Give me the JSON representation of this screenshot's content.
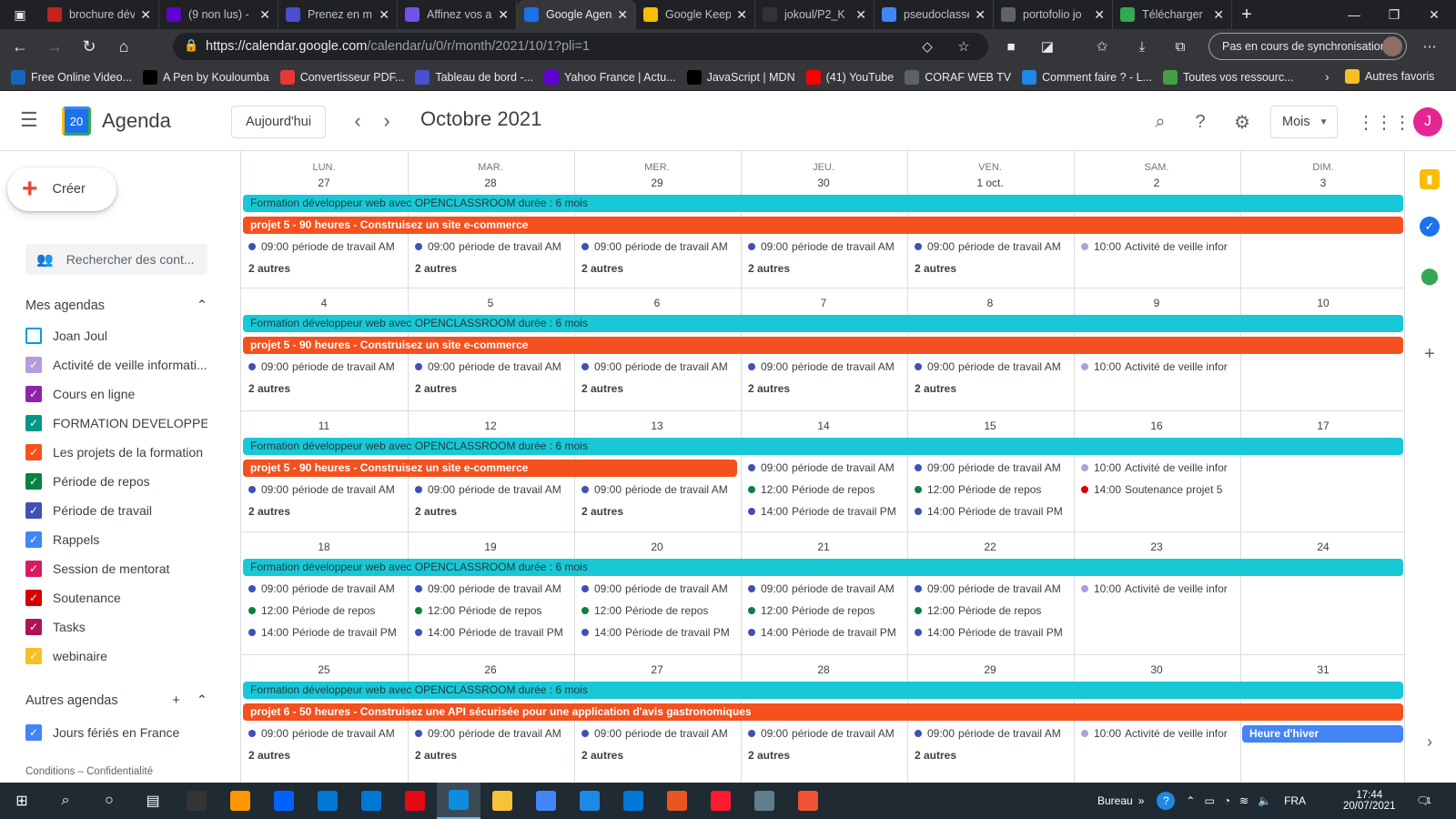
{
  "browser": {
    "tabs": [
      {
        "title": "brochure dév",
        "color": "#c5221f"
      },
      {
        "title": "(9 non lus) -",
        "color": "#6001d2"
      },
      {
        "title": "Prenez en m",
        "color": "#4a4ed1"
      },
      {
        "title": "Affinez vos a",
        "color": "#7451eb"
      },
      {
        "title": "Google Agen",
        "color": "#1a73e8"
      },
      {
        "title": "Google Keep",
        "color": "#fbbc04"
      },
      {
        "title": "jokoul/P2_K",
        "color": "#333333"
      },
      {
        "title": "pseudoclasse",
        "color": "#4285f4"
      },
      {
        "title": "portofolio jo",
        "color": "#5f6368"
      },
      {
        "title": "Télécharger",
        "color": "#34a853"
      }
    ],
    "active_tab_index": 4,
    "url_host": "https://calendar.google.com",
    "url_path": "/calendar/u/0/r/month/2021/10/1?pli=1",
    "sync_label": "Pas en cours de synchronisation",
    "bookmarks": [
      {
        "label": "Free Online Video...",
        "color": "#1565c0"
      },
      {
        "label": "A Pen by Kouloumba",
        "color": "#000000"
      },
      {
        "label": "Convertisseur PDF...",
        "color": "#e53935"
      },
      {
        "label": "Tableau de bord -...",
        "color": "#4a4ed1"
      },
      {
        "label": "Yahoo France | Actu...",
        "color": "#6001d2"
      },
      {
        "label": "JavaScript | MDN",
        "color": "#000000"
      },
      {
        "label": "(41) YouTube",
        "color": "#ff0000"
      },
      {
        "label": "CORAF WEB TV",
        "color": "#5f6368"
      },
      {
        "label": "Comment faire ? - L...",
        "color": "#1e88e5"
      },
      {
        "label": "Toutes vos ressourc...",
        "color": "#43a047"
      }
    ],
    "other_bookmarks": "Autres favoris"
  },
  "app": {
    "title": "Agenda",
    "logo_day": "20",
    "today_label": "Aujourd'hui",
    "month_title": "Octobre 2021",
    "view_label": "Mois",
    "avatar_letter": "J"
  },
  "sidebar": {
    "create_label": "Créer",
    "search_placeholder": "Rechercher des cont...",
    "my_calendars_title": "Mes agendas",
    "my_calendars": [
      {
        "label": "Joan Joul",
        "color": "#039be5",
        "checked": false
      },
      {
        "label": "Activité de veille informati...",
        "color": "#b39ddb",
        "checked": true
      },
      {
        "label": "Cours en ligne",
        "color": "#8e24aa",
        "checked": true
      },
      {
        "label": "FORMATION DEVELOPPE...",
        "color": "#009688",
        "checked": true
      },
      {
        "label": "Les projets de la formation",
        "color": "#f4511e",
        "checked": true
      },
      {
        "label": "Période de repos",
        "color": "#0b8043",
        "checked": true
      },
      {
        "label": "Période de travail",
        "color": "#3f51b5",
        "checked": true
      },
      {
        "label": "Rappels",
        "color": "#4285f4",
        "checked": true
      },
      {
        "label": "Session de mentorat",
        "color": "#d81b60",
        "checked": true
      },
      {
        "label": "Soutenance",
        "color": "#d50000",
        "checked": true
      },
      {
        "label": "Tasks",
        "color": "#ad1457",
        "checked": true
      },
      {
        "label": "webinaire",
        "color": "#f6bf26",
        "checked": true
      }
    ],
    "other_calendars_title": "Autres agendas",
    "other_calendars": [
      {
        "label": "Jours fériés en France",
        "color": "#4285f4",
        "checked": true
      }
    ],
    "footer": "Conditions – Confidentialité"
  },
  "calendar": {
    "day_names": [
      "LUN.",
      "MAR.",
      "MER.",
      "JEU.",
      "VEN.",
      "SAM.",
      "DIM."
    ],
    "weeks": [
      {
        "days": [
          "27",
          "28",
          "29",
          "30",
          "1 oct.",
          "2",
          "3"
        ],
        "bars": [
          {
            "label": "Formation développeur web avec OPENCLASSROOM durée : 6 mois",
            "type": "teal",
            "row": 0,
            "start": 0,
            "end": 7
          },
          {
            "label": "projet 5 - 90 heures - Construisez un site e-commerce",
            "type": "orange",
            "row": 1,
            "start": 0,
            "end": 7
          }
        ],
        "events": [
          {
            "col": 0,
            "row": 2,
            "time": "09:00",
            "text": "période de travail AM",
            "color": "#3f51b5"
          },
          {
            "col": 1,
            "row": 2,
            "time": "09:00",
            "text": "période de travail AM",
            "color": "#3f51b5"
          },
          {
            "col": 2,
            "row": 2,
            "time": "09:00",
            "text": "période de travail AM",
            "color": "#3f51b5"
          },
          {
            "col": 3,
            "row": 2,
            "time": "09:00",
            "text": "période de travail AM",
            "color": "#3f51b5"
          },
          {
            "col": 4,
            "row": 2,
            "time": "09:00",
            "text": "période de travail AM",
            "color": "#3f51b5"
          },
          {
            "col": 5,
            "row": 2,
            "time": "10:00",
            "text": "Activité de veille infor",
            "color": "#b39ddb"
          }
        ],
        "more": [
          {
            "col": 0,
            "row": 3,
            "label": "2 autres"
          },
          {
            "col": 1,
            "row": 3,
            "label": "2 autres"
          },
          {
            "col": 2,
            "row": 3,
            "label": "2 autres"
          },
          {
            "col": 3,
            "row": 3,
            "label": "2 autres"
          },
          {
            "col": 4,
            "row": 3,
            "label": "2 autres"
          }
        ]
      },
      {
        "days": [
          "4",
          "5",
          "6",
          "7",
          "8",
          "9",
          "10"
        ],
        "bars": [
          {
            "label": "Formation développeur web avec OPENCLASSROOM durée : 6 mois",
            "type": "teal",
            "row": 0,
            "start": 0,
            "end": 7
          },
          {
            "label": "projet 5 - 90 heures - Construisez un site e-commerce",
            "type": "orange",
            "row": 1,
            "start": 0,
            "end": 7
          }
        ],
        "events": [
          {
            "col": 0,
            "row": 2,
            "time": "09:00",
            "text": "période de travail AM",
            "color": "#3f51b5"
          },
          {
            "col": 1,
            "row": 2,
            "time": "09:00",
            "text": "période de travail AM",
            "color": "#3f51b5"
          },
          {
            "col": 2,
            "row": 2,
            "time": "09:00",
            "text": "période de travail AM",
            "color": "#3f51b5"
          },
          {
            "col": 3,
            "row": 2,
            "time": "09:00",
            "text": "période de travail AM",
            "color": "#3f51b5"
          },
          {
            "col": 4,
            "row": 2,
            "time": "09:00",
            "text": "période de travail AM",
            "color": "#3f51b5"
          },
          {
            "col": 5,
            "row": 2,
            "time": "10:00",
            "text": "Activité de veille infor",
            "color": "#b39ddb"
          }
        ],
        "more": [
          {
            "col": 0,
            "row": 3,
            "label": "2 autres"
          },
          {
            "col": 1,
            "row": 3,
            "label": "2 autres"
          },
          {
            "col": 2,
            "row": 3,
            "label": "2 autres"
          },
          {
            "col": 3,
            "row": 3,
            "label": "2 autres"
          },
          {
            "col": 4,
            "row": 3,
            "label": "2 autres"
          }
        ]
      },
      {
        "days": [
          "11",
          "12",
          "13",
          "14",
          "15",
          "16",
          "17"
        ],
        "bars": [
          {
            "label": "Formation développeur web avec OPENCLASSROOM durée : 6 mois",
            "type": "teal",
            "row": 0,
            "start": 0,
            "end": 7
          },
          {
            "label": "projet 5 - 90 heures - Construisez un site e-commerce",
            "type": "orange",
            "row": 1,
            "start": 0,
            "end": 3
          }
        ],
        "events": [
          {
            "col": 0,
            "row": 2,
            "time": "09:00",
            "text": "période de travail AM",
            "color": "#3f51b5"
          },
          {
            "col": 1,
            "row": 2,
            "time": "09:00",
            "text": "période de travail AM",
            "color": "#3f51b5"
          },
          {
            "col": 2,
            "row": 2,
            "time": "09:00",
            "text": "période de travail AM",
            "color": "#3f51b5"
          },
          {
            "col": 3,
            "row": 1,
            "time": "09:00",
            "text": "période de travail AM",
            "color": "#3f51b5"
          },
          {
            "col": 3,
            "row": 2,
            "time": "12:00",
            "text": "Période de repos",
            "color": "#0b8043"
          },
          {
            "col": 3,
            "row": 3,
            "time": "14:00",
            "text": "Période de travail PM",
            "color": "#3f51b5"
          },
          {
            "col": 4,
            "row": 1,
            "time": "09:00",
            "text": "période de travail AM",
            "color": "#3f51b5"
          },
          {
            "col": 4,
            "row": 2,
            "time": "12:00",
            "text": "Période de repos",
            "color": "#0b8043"
          },
          {
            "col": 4,
            "row": 3,
            "time": "14:00",
            "text": "Période de travail PM",
            "color": "#3f51b5"
          },
          {
            "col": 5,
            "row": 1,
            "time": "10:00",
            "text": "Activité de veille infor",
            "color": "#b39ddb"
          },
          {
            "col": 5,
            "row": 2,
            "time": "14:00",
            "text": "Soutenance projet 5",
            "color": "#d50000"
          }
        ],
        "more": [
          {
            "col": 0,
            "row": 3,
            "label": "2 autres"
          },
          {
            "col": 1,
            "row": 3,
            "label": "2 autres"
          },
          {
            "col": 2,
            "row": 3,
            "label": "2 autres"
          }
        ]
      },
      {
        "days": [
          "18",
          "19",
          "20",
          "21",
          "22",
          "23",
          "24"
        ],
        "bars": [
          {
            "label": "Formation développeur web avec OPENCLASSROOM durée : 6 mois",
            "type": "teal",
            "row": 0,
            "start": 0,
            "end": 7
          }
        ],
        "events": [
          {
            "col": 0,
            "row": 1,
            "time": "09:00",
            "text": "période de travail AM",
            "color": "#3f51b5"
          },
          {
            "col": 0,
            "row": 2,
            "time": "12:00",
            "text": "Période de repos",
            "color": "#0b8043"
          },
          {
            "col": 0,
            "row": 3,
            "time": "14:00",
            "text": "Période de travail PM",
            "color": "#3f51b5"
          },
          {
            "col": 1,
            "row": 1,
            "time": "09:00",
            "text": "période de travail AM",
            "color": "#3f51b5"
          },
          {
            "col": 1,
            "row": 2,
            "time": "12:00",
            "text": "Période de repos",
            "color": "#0b8043"
          },
          {
            "col": 1,
            "row": 3,
            "time": "14:00",
            "text": "Période de travail PM",
            "color": "#3f51b5"
          },
          {
            "col": 2,
            "row": 1,
            "time": "09:00",
            "text": "période de travail AM",
            "color": "#3f51b5"
          },
          {
            "col": 2,
            "row": 2,
            "time": "12:00",
            "text": "Période de repos",
            "color": "#0b8043"
          },
          {
            "col": 2,
            "row": 3,
            "time": "14:00",
            "text": "Période de travail PM",
            "color": "#3f51b5"
          },
          {
            "col": 3,
            "row": 1,
            "time": "09:00",
            "text": "période de travail AM",
            "color": "#3f51b5"
          },
          {
            "col": 3,
            "row": 2,
            "time": "12:00",
            "text": "Période de repos",
            "color": "#0b8043"
          },
          {
            "col": 3,
            "row": 3,
            "time": "14:00",
            "text": "Période de travail PM",
            "color": "#3f51b5"
          },
          {
            "col": 4,
            "row": 1,
            "time": "09:00",
            "text": "période de travail AM",
            "color": "#3f51b5"
          },
          {
            "col": 4,
            "row": 2,
            "time": "12:00",
            "text": "Période de repos",
            "color": "#0b8043"
          },
          {
            "col": 4,
            "row": 3,
            "time": "14:00",
            "text": "Période de travail PM",
            "color": "#3f51b5"
          },
          {
            "col": 5,
            "row": 1,
            "time": "10:00",
            "text": "Activité de veille infor",
            "color": "#b39ddb"
          }
        ],
        "more": []
      },
      {
        "days": [
          "25",
          "26",
          "27",
          "28",
          "29",
          "30",
          "31"
        ],
        "bars": [
          {
            "label": "Formation développeur web avec OPENCLASSROOM durée : 6 mois",
            "type": "teal",
            "row": 0,
            "start": 0,
            "end": 7
          },
          {
            "label": "projet 6 - 50 heures - Construisez une API sécurisée pour une application d'avis gastronomiques",
            "type": "orange",
            "row": 1,
            "start": 0,
            "end": 7
          },
          {
            "label": "Heure d'hiver",
            "type": "blue",
            "row": 2,
            "start": 6,
            "end": 7
          }
        ],
        "events": [
          {
            "col": 0,
            "row": 2,
            "time": "09:00",
            "text": "période de travail AM",
            "color": "#3f51b5"
          },
          {
            "col": 1,
            "row": 2,
            "time": "09:00",
            "text": "période de travail AM",
            "color": "#3f51b5"
          },
          {
            "col": 2,
            "row": 2,
            "time": "09:00",
            "text": "période de travail AM",
            "color": "#3f51b5"
          },
          {
            "col": 3,
            "row": 2,
            "time": "09:00",
            "text": "période de travail AM",
            "color": "#3f51b5"
          },
          {
            "col": 4,
            "row": 2,
            "time": "09:00",
            "text": "période de travail AM",
            "color": "#3f51b5"
          },
          {
            "col": 5,
            "row": 2,
            "time": "10:00",
            "text": "Activité de veille infor",
            "color": "#b39ddb"
          }
        ],
        "more": [
          {
            "col": 0,
            "row": 3,
            "label": "2 autres"
          },
          {
            "col": 1,
            "row": 3,
            "label": "2 autres"
          },
          {
            "col": 2,
            "row": 3,
            "label": "2 autres"
          },
          {
            "col": 3,
            "row": 3,
            "label": "2 autres"
          },
          {
            "col": 4,
            "row": 3,
            "label": "2 autres"
          }
        ]
      }
    ]
  },
  "taskbar": {
    "apps": [
      {
        "name": "terminal",
        "color": "#333333"
      },
      {
        "name": "sublime",
        "color": "#ff9800"
      },
      {
        "name": "dropbox",
        "color": "#0061fe"
      },
      {
        "name": "store",
        "color": "#0078d4"
      },
      {
        "name": "mail",
        "color": "#0078d4"
      },
      {
        "name": "netflix",
        "color": "#e50914"
      },
      {
        "name": "edge",
        "color": "#0c8de0"
      },
      {
        "name": "explorer",
        "color": "#f7c23a"
      },
      {
        "name": "chrome",
        "color": "#4285f4"
      },
      {
        "name": "media",
        "color": "#1e88e5"
      },
      {
        "name": "vscode",
        "color": "#0078d7"
      },
      {
        "name": "ubuntu",
        "color": "#e95420"
      },
      {
        "name": "opera",
        "color": "#ff1b2d"
      },
      {
        "name": "notepad",
        "color": "#607d8b"
      },
      {
        "name": "git",
        "color": "#f05133"
      }
    ],
    "active_index": 6,
    "desktop_label": "Bureau",
    "lang": "FRA",
    "time": "17:44",
    "date": "20/07/2021",
    "notif_count": "1"
  }
}
